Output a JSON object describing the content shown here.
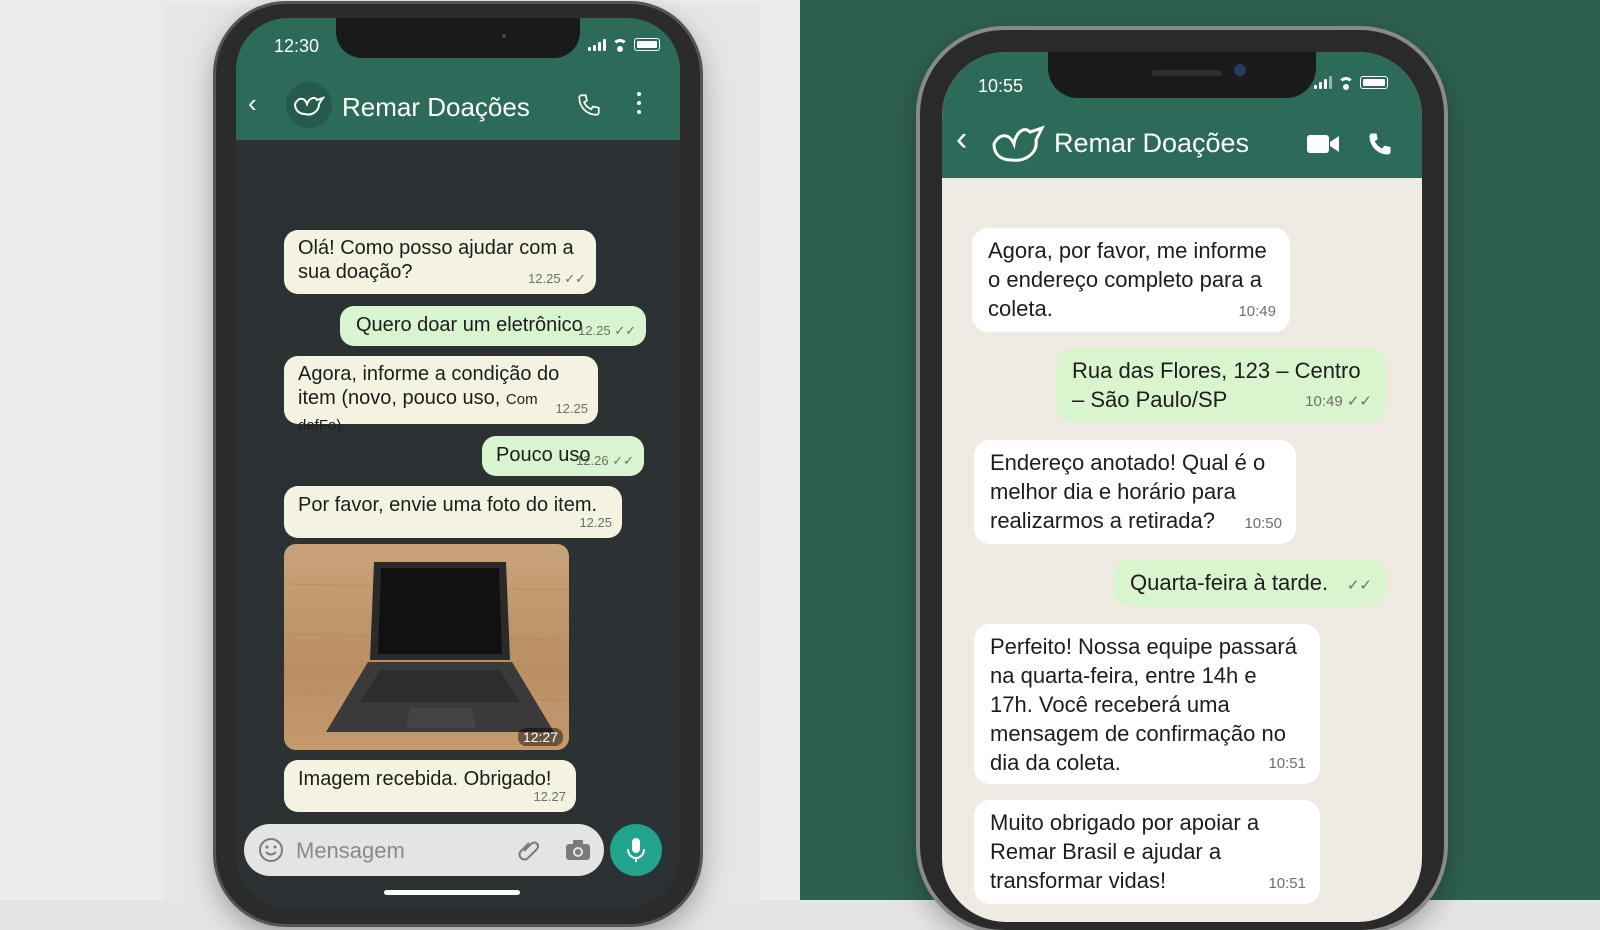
{
  "left_phone": {
    "status_time": "12:30",
    "header": {
      "title": "Remar Doações"
    },
    "messages": [
      {
        "dir": "in",
        "text": "Olá! Como posso ajudar com a sua doação?",
        "time": "12.25"
      },
      {
        "dir": "out",
        "text": "Quero doar um eletrônico",
        "time": "12.25"
      },
      {
        "dir": "in",
        "text_main": "Agora, informe a condição do item (novo, pouco uso,",
        "text_small": "Com defFo).",
        "time": "12.25"
      },
      {
        "dir": "out",
        "text": "Pouco uso",
        "time": "12.26"
      },
      {
        "dir": "in",
        "text": "Por favor, envie uma foto do item.",
        "time": "12.25"
      },
      {
        "dir": "in",
        "type": "image",
        "time": "12:27"
      },
      {
        "dir": "in",
        "text": "Imagem recebida. Obrigado!",
        "time": "12.27"
      }
    ],
    "input_placeholder": "Mensagem"
  },
  "right_phone": {
    "status_time": "10:55",
    "header": {
      "title": "Remar Doações"
    },
    "messages": [
      {
        "dir": "in",
        "text": "Agora, por favor, me informe o endereço completo para a coleta.",
        "time": "10:49"
      },
      {
        "dir": "out",
        "text": "Rua das Flores, 123 – Centro – São Paulo/SP",
        "time": "10:49"
      },
      {
        "dir": "in",
        "text": "Endereço anotado! Qual é o melhor dia e horário para realizarmos a retirada?",
        "time": "10:50"
      },
      {
        "dir": "out",
        "text": "Quarta-feira à tarde.",
        "time": ""
      },
      {
        "dir": "in",
        "text": "Perfeito! Nossa equipe passará na quarta-feira, entre 14h e 17h. Você receberá uma mensagem de confirmação no dia da coleta.",
        "time": "10:51"
      },
      {
        "dir": "in",
        "text": "Muito obrigado por apoiar a Remar Brasil e ajudar a transformar vidas!",
        "time": "10:51"
      }
    ]
  },
  "colors": {
    "header_green": "#2c6a5a",
    "outgoing_bubble": "#d9f5cf",
    "mic_button": "#21a38d",
    "right_background": "#2d5f50"
  }
}
